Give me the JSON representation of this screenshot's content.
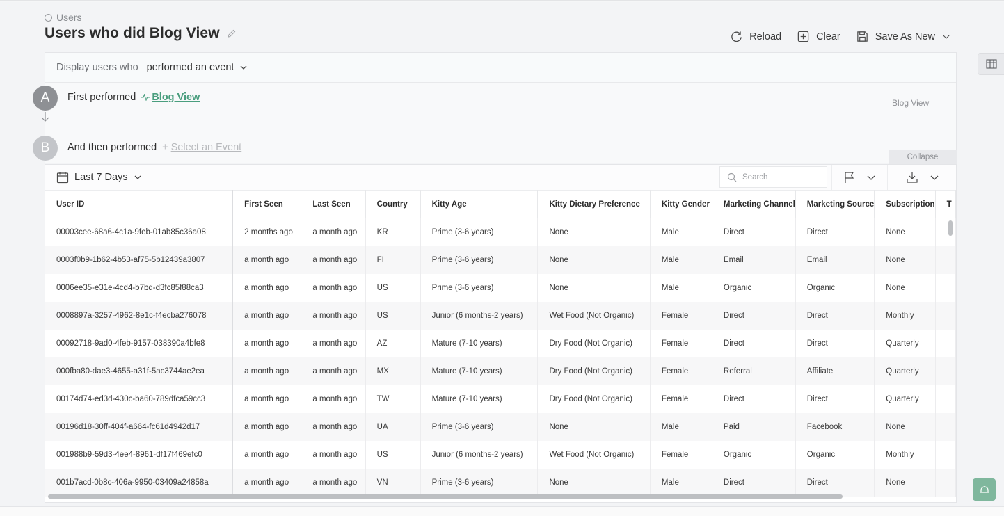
{
  "breadcrumb": {
    "label": "Users"
  },
  "page": {
    "title": "Users who did Blog View"
  },
  "actions": {
    "reload": "Reload",
    "clear": "Clear",
    "save": "Save As New"
  },
  "query": {
    "display_label": "Display users who",
    "display_value": "performed an event",
    "step_a": {
      "badge": "A",
      "label": "First performed",
      "event": "Blog View"
    },
    "step_b": {
      "badge": "B",
      "label": "And then performed",
      "event": "Select an Event"
    },
    "tag": "Blog View",
    "collapse": "Collapse"
  },
  "toolbar": {
    "date_range": "Last 7 Days",
    "search_placeholder": "Search"
  },
  "table": {
    "columns": [
      "User ID",
      "First Seen",
      "Last Seen",
      "Country",
      "Kitty Age",
      "Kitty Dietary Preference",
      "Kitty Gender",
      "Marketing Channel",
      "Marketing Source",
      "Subscription",
      "T"
    ],
    "rows": [
      [
        "00003cee-68a6-4c1a-9feb-01ab85c36a08",
        "2 months ago",
        "a month ago",
        "KR",
        "Prime (3-6 years)",
        "None",
        "Male",
        "Direct",
        "Direct",
        "None",
        ""
      ],
      [
        "0003f0b9-1b62-4b53-af75-5b12439a3807",
        "a month ago",
        "a month ago",
        "FI",
        "Prime (3-6 years)",
        "None",
        "Male",
        "Email",
        "Email",
        "None",
        ""
      ],
      [
        "0006ee35-e31e-4cd4-b7bd-d3fc85f88ca3",
        "a month ago",
        "a month ago",
        "US",
        "Prime (3-6 years)",
        "None",
        "Male",
        "Organic",
        "Organic",
        "None",
        ""
      ],
      [
        "0008897a-3257-4962-8e1c-f4ecba276078",
        "a month ago",
        "a month ago",
        "US",
        "Junior (6 months-2 years)",
        "Wet Food (Not Organic)",
        "Female",
        "Direct",
        "Direct",
        "Monthly",
        ""
      ],
      [
        "00092718-9ad0-4feb-9157-038390a4bfe8",
        "a month ago",
        "a month ago",
        "AZ",
        "Mature (7-10 years)",
        "Dry Food (Not Organic)",
        "Female",
        "Direct",
        "Direct",
        "Quarterly",
        ""
      ],
      [
        "000fba80-dae3-4655-a31f-5ac3744ae2ea",
        "a month ago",
        "a month ago",
        "MX",
        "Mature (7-10 years)",
        "Dry Food (Not Organic)",
        "Female",
        "Referral",
        "Affiliate",
        "Quarterly",
        ""
      ],
      [
        "00174d74-ed3d-430c-ba60-789dfca59cc3",
        "a month ago",
        "a month ago",
        "TW",
        "Mature (7-10 years)",
        "Dry Food (Not Organic)",
        "Female",
        "Direct",
        "Direct",
        "Quarterly",
        ""
      ],
      [
        "00196d18-30ff-404f-a664-fc61d4942d17",
        "a month ago",
        "a month ago",
        "UA",
        "Prime (3-6 years)",
        "None",
        "Male",
        "Paid",
        "Facebook",
        "None",
        ""
      ],
      [
        "001988b9-59d3-4ee4-8961-df17f469efc0",
        "a month ago",
        "a month ago",
        "US",
        "Junior (6 months-2 years)",
        "Wet Food (Not Organic)",
        "Female",
        "Organic",
        "Organic",
        "Monthly",
        ""
      ],
      [
        "001b7acd-0b8c-406a-9950-03409a24858a",
        "a month ago",
        "a month ago",
        "VN",
        "Prime (3-6 years)",
        "None",
        "Male",
        "Direct",
        "Direct",
        "None",
        ""
      ]
    ]
  },
  "colors": {
    "accent": "#4a9e7e",
    "badge_active": "#8e9094",
    "badge_inactive": "#c3c5c9"
  }
}
